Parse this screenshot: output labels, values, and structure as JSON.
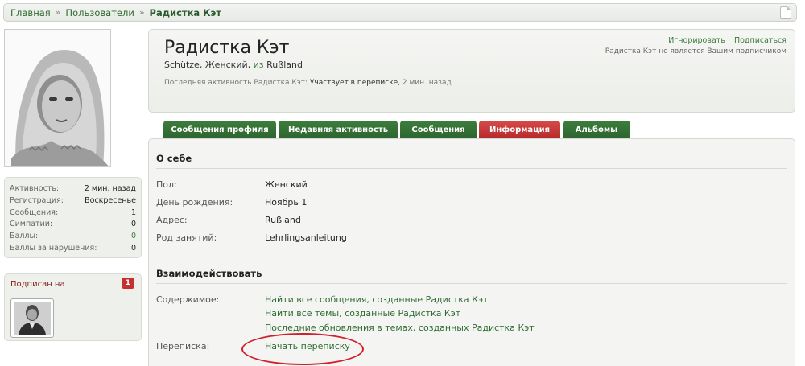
{
  "breadcrumb": {
    "items": [
      "Главная",
      "Пользователи",
      "Радистка Кэт"
    ],
    "separator": "»"
  },
  "sidebar": {
    "stats": [
      {
        "label": "Активность:",
        "value": "2 мин. назад",
        "green": false
      },
      {
        "label": "Регистрация:",
        "value": "Воскресенье",
        "green": false
      },
      {
        "label": "Сообщения:",
        "value": "1",
        "green": false
      },
      {
        "label": "Симпатии:",
        "value": "0",
        "green": false
      },
      {
        "label": "Баллы:",
        "value": "0",
        "green": true
      },
      {
        "label": "Баллы за нарушения:",
        "value": "0",
        "green": false
      }
    ],
    "following": {
      "title": "Подписан на",
      "count": "1"
    }
  },
  "profile": {
    "name": "Радистка Кэт",
    "info_title": "Schütze",
    "info_gender": "Женский",
    "info_from": "из",
    "info_location": "Rußland",
    "activity_prefix": "Последняя активность Радистка Кэт:",
    "activity_action": "Участвует в переписке,",
    "activity_time": "2 мин. назад",
    "ignore_label": "Игнорировать",
    "follow_label": "Подписаться",
    "follow_note": "Радистка Кэт не является Вашим подписчиком"
  },
  "tabs": [
    {
      "label": "Сообщения профиля",
      "active": false
    },
    {
      "label": "Недавняя активность",
      "active": false
    },
    {
      "label": "Сообщения",
      "active": false
    },
    {
      "label": "Информация",
      "active": true
    },
    {
      "label": "Альбомы",
      "active": false
    }
  ],
  "about": {
    "heading": "О себе",
    "rows": [
      {
        "label": "Пол:",
        "value": "Женский"
      },
      {
        "label": "День рождения:",
        "value": "Ноябрь 1"
      },
      {
        "label": "Адрес:",
        "value": "Rußland"
      },
      {
        "label": "Род занятий:",
        "value": "Lehrlingsanleitung"
      }
    ]
  },
  "interact": {
    "heading": "Взаимодействовать",
    "content_label": "Содержимое:",
    "content_links": [
      "Найти все сообщения, созданные Радистка Кэт",
      "Найти все темы, созданные Радистка Кэт",
      "Последние обновления в темах, созданных Радистка Кэт"
    ],
    "conversation_label": "Переписка:",
    "conversation_link": "Начать переписку"
  },
  "colors": {
    "accent_green": "#2f6b33",
    "tab_green": "#3d7e3c",
    "tab_active_red": "#c53030",
    "highlight_red": "#d0202c"
  }
}
